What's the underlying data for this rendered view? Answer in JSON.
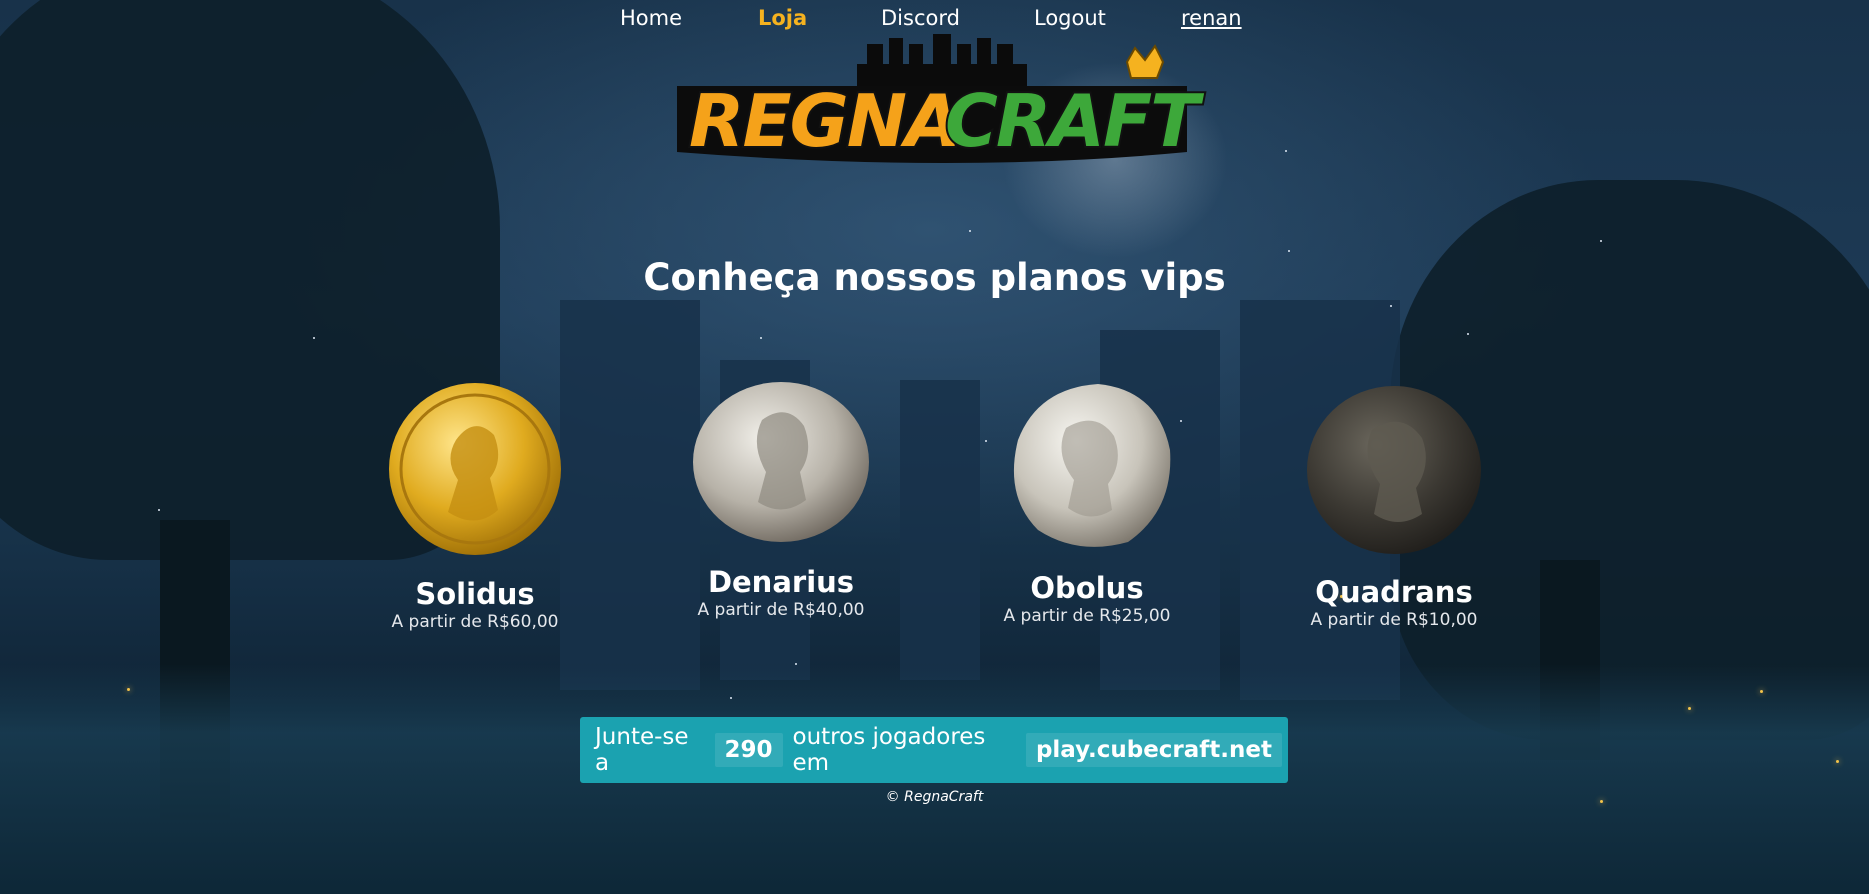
{
  "nav": {
    "home": "Home",
    "store": "Loja",
    "discord": "Discord",
    "logout": "Logout",
    "user": "renan"
  },
  "logo": {
    "part1": "REGNA",
    "part2": "CRAFT",
    "color1": "#f5a21a",
    "color2": "#3da83a"
  },
  "headline": "Conheça nossos planos vips",
  "plans": [
    {
      "name": "Solidus",
      "price": "A partir de R$60,00",
      "coin": "gold-coin-icon"
    },
    {
      "name": "Denarius",
      "price": "A partir de R$40,00",
      "coin": "silver-coin-icon"
    },
    {
      "name": "Obolus",
      "price": "A partir de R$25,00",
      "coin": "silver-coin-icon"
    },
    {
      "name": "Quadrans",
      "price": "A partir de R$10,00",
      "coin": "bronze-coin-icon"
    }
  ],
  "join": {
    "prefix": "Junte-se a",
    "count": "290",
    "middle": "outros jogadores em",
    "server": "play.cubecraft.net"
  },
  "footer": "© RegnaCraft",
  "colors": {
    "accent": "#f5b21f",
    "join_bg": "#1ba2b0"
  }
}
